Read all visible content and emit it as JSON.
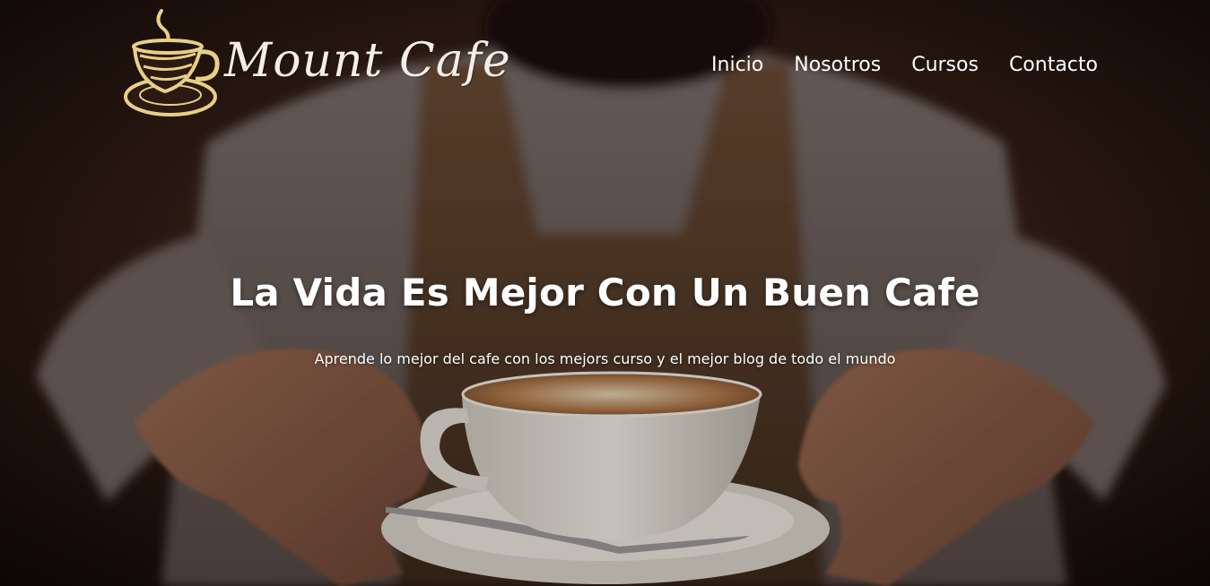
{
  "colors": {
    "nav_text": "#ffffff",
    "hero_text": "#ffffff",
    "logo_text": "#f3efe8",
    "logo_gold": "#e8cf86"
  },
  "logo": {
    "text": "Mount Cafe",
    "icon": "coffee-cup-icon"
  },
  "nav": {
    "items": [
      {
        "label": "Inicio"
      },
      {
        "label": "Nosotros"
      },
      {
        "label": "Cursos"
      },
      {
        "label": "Contacto"
      }
    ]
  },
  "hero": {
    "title": "La Vida Es Mejor Con Un Buen Cafe",
    "subtitle": "Aprende lo mejor del cafe con los mejors curso y el mejor blog de todo el mundo",
    "background": "barista-holding-cappuccino-photo"
  }
}
